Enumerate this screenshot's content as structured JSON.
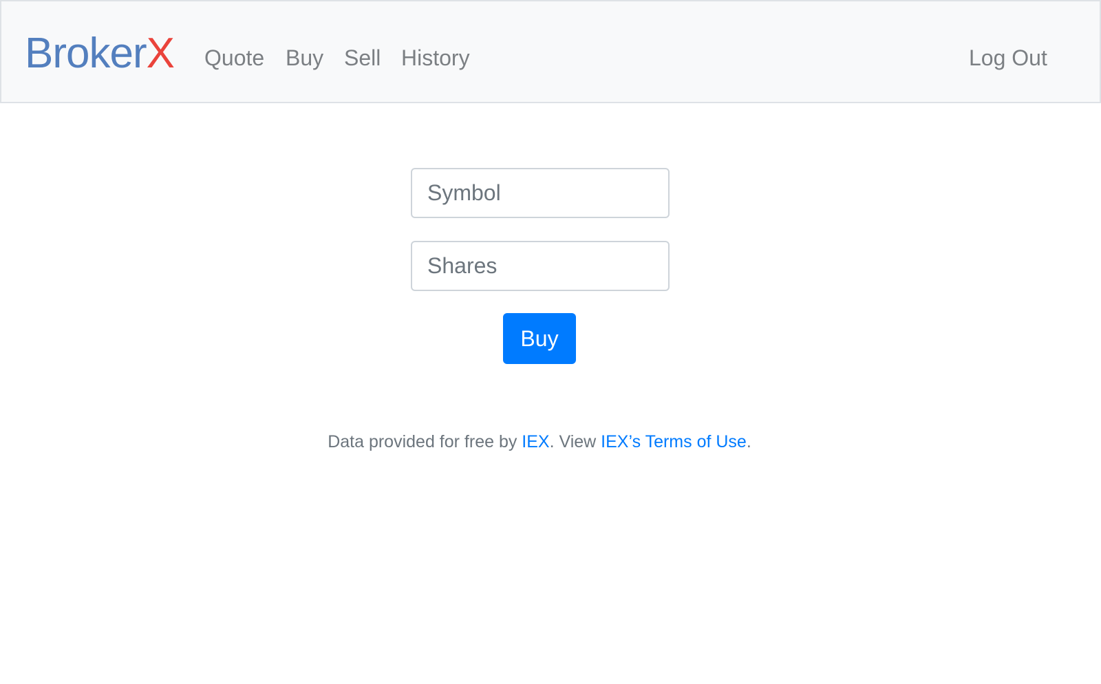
{
  "navbar": {
    "brand": {
      "part1": "Broker",
      "part2": "X",
      "color_primary": "#537fbe",
      "color_accent": "#ea433b"
    },
    "links": {
      "quote": "Quote",
      "buy": "Buy",
      "sell": "Sell",
      "history": "History"
    },
    "logout": "Log Out"
  },
  "form": {
    "symbol_placeholder": "Symbol",
    "shares_placeholder": "Shares",
    "symbol_value": "",
    "shares_value": "",
    "submit_label": "Buy",
    "submit_color": "#007bff"
  },
  "footer": {
    "text_before": "Data provided for free by ",
    "iex_link": "IEX",
    "text_middle": ". View ",
    "terms_link": "IEX’s Terms of Use",
    "text_after": ".",
    "link_color": "#007bff"
  }
}
